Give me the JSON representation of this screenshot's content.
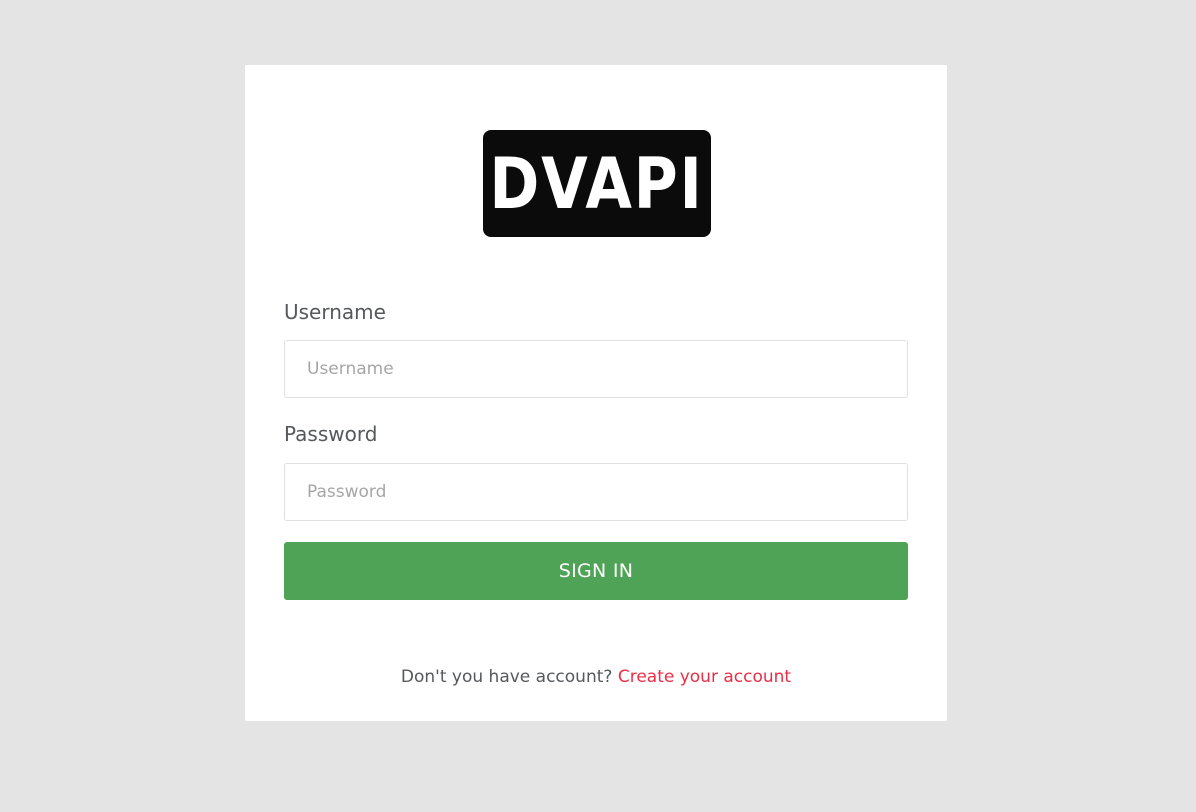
{
  "logo": {
    "text": "DVAPI"
  },
  "form": {
    "username": {
      "label": "Username",
      "placeholder": "Username",
      "value": ""
    },
    "password": {
      "label": "Password",
      "placeholder": "Password",
      "value": ""
    },
    "submit_label": "SIGN IN"
  },
  "footer": {
    "prompt": "Don't you have account?",
    "link_text": "Create your account"
  },
  "colors": {
    "page_background": "#e4e4e4",
    "card_background": "#ffffff",
    "primary_button": "#4fa356",
    "link": "#ec2e45",
    "logo_background": "#0b0b0b"
  }
}
